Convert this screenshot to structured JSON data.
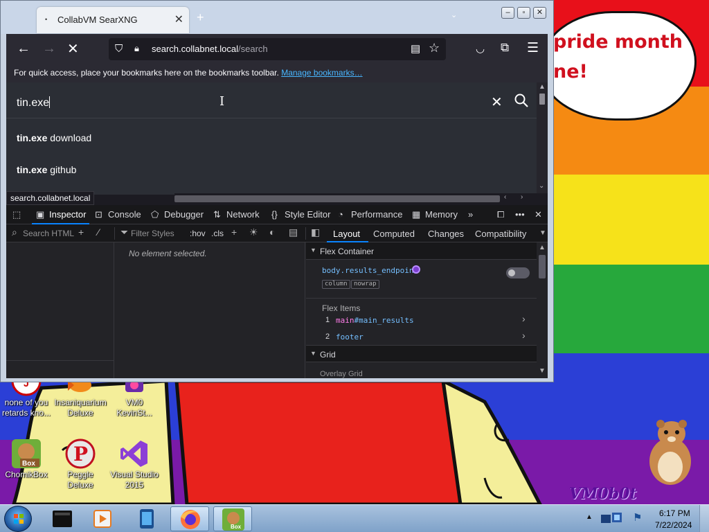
{
  "browser": {
    "tab_title": "CollabVM SearXNG",
    "tab_favicon": "•",
    "tab_close": "✕",
    "new_tab": "+",
    "url_host": "search.collabnet.local",
    "url_path": "/search",
    "bookmarks_prompt": "For quick access, place your bookmarks here on the bookmarks toolbar.",
    "bookmarks_link": "Manage bookmarks…",
    "icons": {
      "back": "back-arrow-icon",
      "forward": "forward-arrow-icon",
      "stop": "stop-icon",
      "shield": "tracking-protection-icon",
      "lock": "lock-icon",
      "reader": "reader-view-icon",
      "star": "bookmark-star-icon",
      "pocket": "pocket-icon",
      "extensions": "extensions-icon",
      "menu": "hamburger-menu-icon"
    }
  },
  "search": {
    "query": "tin.exe",
    "suggestions": [
      {
        "bold": "tin.exe",
        "rest": " download"
      },
      {
        "bold": "tin.exe",
        "rest": " github"
      }
    ],
    "status_url": "search.collabnet.local"
  },
  "devtools": {
    "tabs": [
      {
        "label": "Inspector",
        "icon": "inspector-icon",
        "active": true
      },
      {
        "label": "Console",
        "icon": "console-icon",
        "active": false
      },
      {
        "label": "Debugger",
        "icon": "debugger-icon",
        "active": false
      },
      {
        "label": "Network",
        "icon": "network-icon",
        "active": false
      },
      {
        "label": "Style Editor",
        "icon": "style-editor-icon",
        "active": false
      },
      {
        "label": "Performance",
        "icon": "performance-icon",
        "active": false
      },
      {
        "label": "Memory",
        "icon": "memory-icon",
        "active": false
      }
    ],
    "search_html_placeholder": "Search HTML",
    "filter_styles_placeholder": "Filter Styles",
    "hov": ":hov",
    "cls": ".cls",
    "right_tabs": [
      "Layout",
      "Computed",
      "Changes",
      "Compatibility"
    ],
    "no_element": "No element selected.",
    "flex_container_title": "Flex Container",
    "flex_selector": "body.results_endpoint",
    "flex_pills": [
      "column",
      "nowrap"
    ],
    "flex_items_title": "Flex Items",
    "flex_items": [
      {
        "num": "1",
        "tag": "main",
        "id": "#main_results"
      },
      {
        "num": "2",
        "tag": "footer",
        "id": ""
      }
    ],
    "grid_title": "Grid",
    "overlay_grid": "Overlay Grid"
  },
  "wallpaper": {
    "speech_line1": "pride month",
    "speech_line2": "ne!",
    "vm_tag": "VM0b0t"
  },
  "desktop_icons": [
    {
      "label": "none of you retards kno..."
    },
    {
      "label": "Insaniquarium Deluxe"
    },
    {
      "label": "VM0 KevinSt..."
    },
    {
      "label": "ChomikBox"
    },
    {
      "label": "Peggle Deluxe"
    },
    {
      "label": "Visual Studio 2015"
    }
  ],
  "taskbar": {
    "clock_time": "6:17 PM",
    "clock_date": "7/22/2024"
  },
  "colors": {
    "accent": "#0a84ff",
    "link": "#48b6ff",
    "selector": "#75bfff",
    "tag": "#ff7de9",
    "flex_dot": "#7d3fd1"
  }
}
